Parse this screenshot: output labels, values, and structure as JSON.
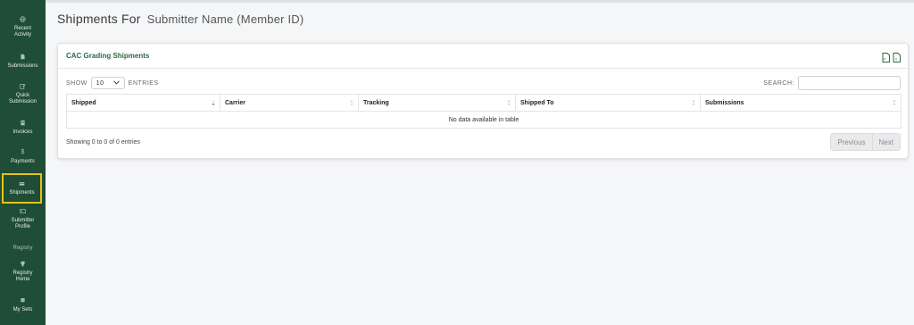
{
  "sidebar": {
    "items": [
      {
        "line1": "Recent",
        "line2": "Activity",
        "icon": "globe-icon"
      },
      {
        "line1": "Submissions",
        "line2": "",
        "icon": "document-icon"
      },
      {
        "line1": "Quick",
        "line2": "Submission",
        "icon": "edit-icon"
      },
      {
        "line1": "Invoices",
        "line2": "",
        "icon": "invoice-icon"
      },
      {
        "line1": "Payments",
        "line2": "",
        "icon": "dollar-icon"
      },
      {
        "line1": "Shipments",
        "line2": "",
        "icon": "truck-icon"
      },
      {
        "line1": "Submitter",
        "line2": "Profile",
        "icon": "id-card-icon"
      },
      {
        "line1": "Registry",
        "line2": "Home",
        "icon": "trophy-icon"
      },
      {
        "line1": "My Sets",
        "line2": "",
        "icon": "coins-icon"
      }
    ],
    "section_label": "Registry"
  },
  "header": {
    "title": "Shipments For",
    "subtitle": "Submitter Name (Member ID)"
  },
  "card": {
    "title": "CAC Grading Shipments",
    "show_label": "SHOW",
    "entries_value": "10",
    "entries_label": "ENTRIES",
    "search_label": "SEARCH:",
    "search_value": "",
    "columns": [
      "Shipped",
      "Carrier",
      "Tracking",
      "Shipped To",
      "Submissions"
    ],
    "empty_message": "No data available in table",
    "info": "Showing 0 to 0 of 0 entries",
    "prev_label": "Previous",
    "next_label": "Next"
  },
  "colors": {
    "sidebar_bg": "#1f4d35",
    "accent": "#2a6a45",
    "active_outline": "#e3c21b"
  }
}
